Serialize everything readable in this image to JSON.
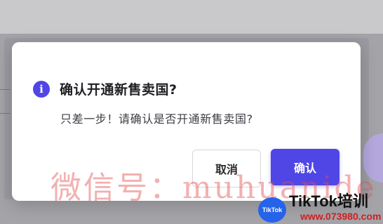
{
  "dialog": {
    "title": "确认开通新售卖国?",
    "message": "只差一步！请确认是否开通新售卖国?",
    "info_icon_glyph": "i",
    "cancel_label": "取消",
    "confirm_label": "确认"
  },
  "watermark": {
    "text": "微信号：muhuanide",
    "logo_text": "TikTok",
    "brand_text": "TikTok培训",
    "site_text": "www.073980.com"
  },
  "colors": {
    "accent": "#4f46e5",
    "overlay": "#8f8f96",
    "watermark_red": "#d21f1f"
  },
  "icons": {
    "info": "info-icon"
  }
}
